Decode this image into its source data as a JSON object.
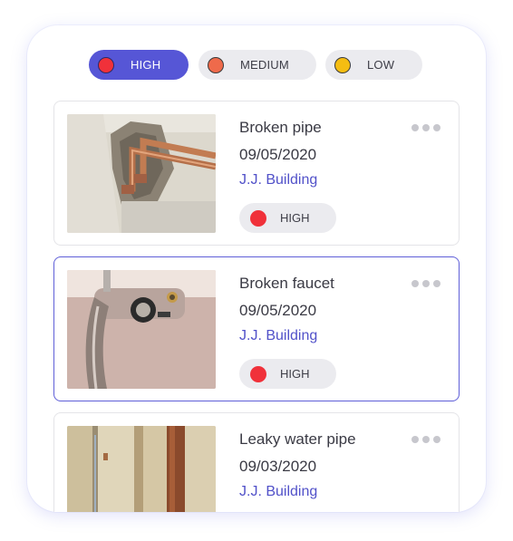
{
  "filters": [
    {
      "label": "HIGH",
      "color": "#f0313a",
      "active": true
    },
    {
      "label": "MEDIUM",
      "color": "#ef6a4b",
      "active": false
    },
    {
      "label": "LOW",
      "color": "#f5bd12",
      "active": false
    }
  ],
  "accent_color": "#5656d6",
  "issues": [
    {
      "title": "Broken pipe",
      "date": "09/05/2020",
      "location": "J.J. Building",
      "priority": "HIGH",
      "priority_color": "#f0313a",
      "image": "broken-pipe-photo",
      "selected": false
    },
    {
      "title": "Broken faucet",
      "date": "09/05/2020",
      "location": "J.J. Building",
      "priority": "HIGH",
      "priority_color": "#f0313a",
      "image": "broken-faucet-photo",
      "selected": true
    },
    {
      "title": "Leaky water pipe",
      "date": "09/03/2020",
      "location": "J.J. Building",
      "priority": "",
      "priority_color": "",
      "image": "leaky-pipe-photo",
      "selected": false
    }
  ],
  "icons": {
    "more": "more-horizontal-icon"
  }
}
